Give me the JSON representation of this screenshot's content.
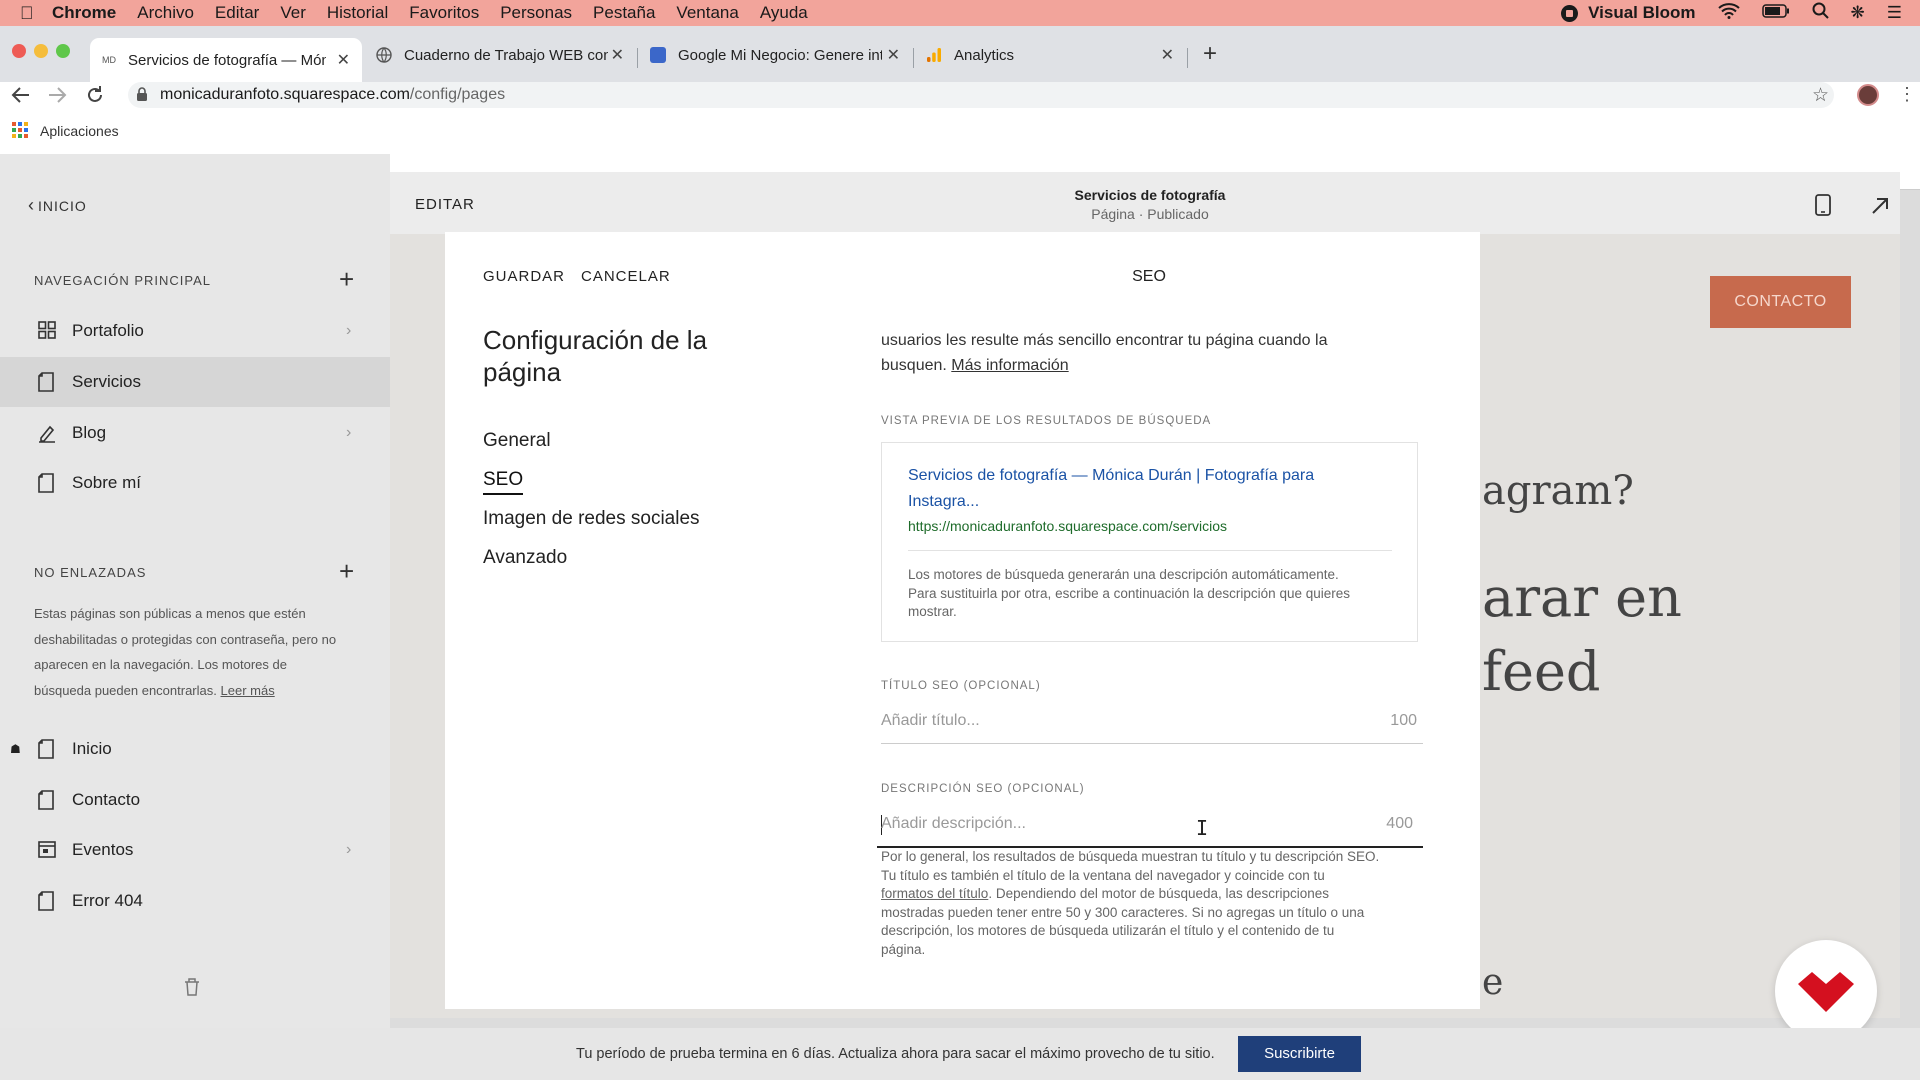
{
  "menubar": {
    "app": "Chrome",
    "items": [
      "Archivo",
      "Editar",
      "Ver",
      "Historial",
      "Favoritos",
      "Personas",
      "Pestaña",
      "Ventana",
      "Ayuda"
    ],
    "right_app": "Visual Bloom"
  },
  "tabs": [
    {
      "title": "Servicios de fotografía — Mónica",
      "favicon": "MD"
    },
    {
      "title": "Cuaderno de Trabajo WEB con",
      "favicon": "globe-icon"
    },
    {
      "title": "Google Mi Negocio: Genere int",
      "favicon": "gmb-icon"
    },
    {
      "title": "Analytics",
      "favicon": "analytics-icon"
    }
  ],
  "address": {
    "domain": "monicaduranfoto.squarespace.com",
    "path": "/config/pages"
  },
  "bookmarks": {
    "apps_label": "Aplicaciones"
  },
  "sidebar": {
    "back_label": "INICIO",
    "main_nav_header": "NAVEGACIÓN PRINCIPAL",
    "main_items": [
      {
        "label": "Portafolio"
      },
      {
        "label": "Servicios"
      },
      {
        "label": "Blog"
      },
      {
        "label": "Sobre mí"
      }
    ],
    "unlinked_header": "NO ENLAZADAS",
    "unlinked_desc_1": "Estas páginas son públicas a menos que estén",
    "unlinked_desc_2": "deshabilitadas o protegidas con contraseña, pero no",
    "unlinked_desc_3": "aparecen en la navegación. Los motores de",
    "unlinked_desc_4": "búsqueda pueden encontrarlas.",
    "unlinked_link": "Leer más",
    "unlinked_items": [
      {
        "label": "Inicio"
      },
      {
        "label": "Contacto"
      },
      {
        "label": "Eventos"
      },
      {
        "label": "Error 404"
      }
    ]
  },
  "topbar": {
    "edit_label": "EDITAR",
    "page_title": "Servicios de fotografía",
    "page_status": "Página · Publicado"
  },
  "site_preview": {
    "contact_button": "CONTACTO",
    "text_1": "agram?",
    "text_2": "arar en",
    "text_3": "feed",
    "text_4": "e"
  },
  "modal": {
    "save": "GUARDAR",
    "cancel": "CANCELAR",
    "title_line1": "Configuración de la",
    "title_line2": "página",
    "nav": [
      "General",
      "SEO",
      "Imagen de redes sociales",
      "Avanzado"
    ],
    "section_title": "SEO",
    "intro_line1": "usuarios les resulte más sencillo encontrar tu página cuando la",
    "intro_line2": "busquen.",
    "intro_link": "Más información",
    "preview_caption": "VISTA PREVIA DE LOS RESULTADOS DE BÚSQUEDA",
    "result_title_1": "Servicios de fotografía — Mónica Durán | Fotografía para",
    "result_title_2": "Instagra...",
    "result_url": "https://monicaduranfoto.squarespace.com/servicios",
    "result_desc_1": "Los motores de búsqueda generarán una descripción automáticamente.",
    "result_desc_2": "Para sustituirla por otra, escribe a continuación la descripción que quieres",
    "result_desc_3": "mostrar.",
    "seo_title_label": "TÍTULO SEO (OPCIONAL)",
    "seo_title_placeholder": "Añadir título...",
    "seo_title_count": "100",
    "seo_desc_label": "DESCRIPCIÓN SEO (OPCIONAL)",
    "seo_desc_placeholder": "Añadir descripción...",
    "seo_desc_count": "400",
    "help_1": "Por lo general, los resultados de búsqueda muestran tu título y tu descripción SEO.",
    "help_2": "Tu título es también el título de la ventana del navegador y coincide con tu",
    "help_link": "formatos del título",
    "help_3": ". Dependiendo del motor de búsqueda, las descripciones",
    "help_4": "mostradas pueden tener entre 50 y 300 caracteres. Si no agregas un título o una",
    "help_5": "descripción, los motores de búsqueda utilizarán el título y el contenido de tu",
    "help_6": "página."
  },
  "trial": {
    "text": "Tu período de prueba termina en 6 días. Actualiza ahora para sacar el máximo provecho de tu sitio.",
    "button": "Suscribirte"
  },
  "colors": {
    "accent_orange": "#c76a4d",
    "link_blue": "#1a52a5",
    "url_green": "#1e6b2a",
    "subscribe_blue": "#1f3f7a",
    "menubar": "#f2a49b"
  }
}
